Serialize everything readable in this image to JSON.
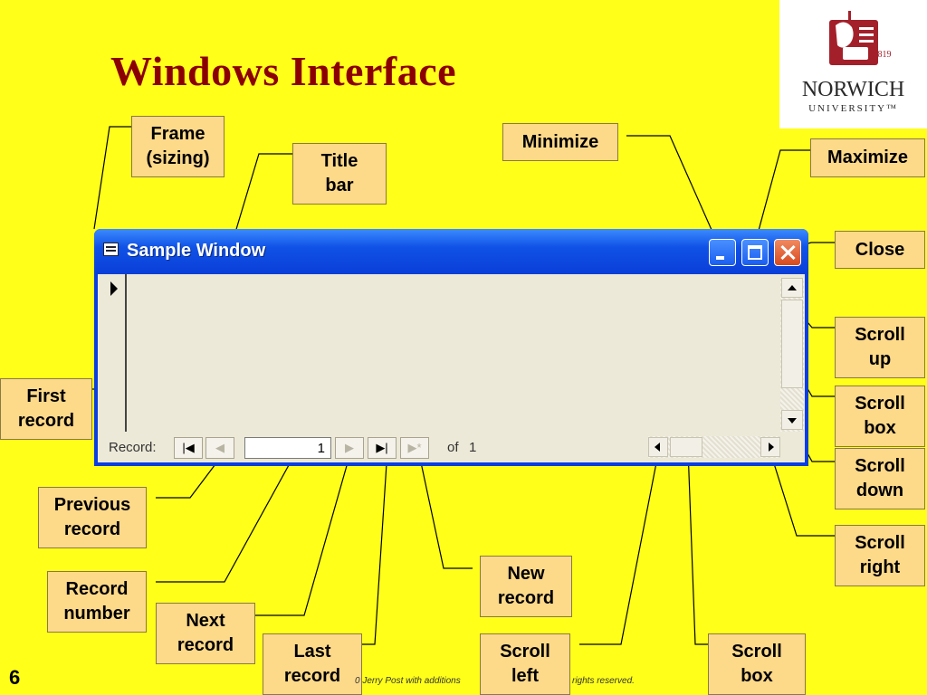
{
  "slide": {
    "title": "Windows Interface",
    "number": "6",
    "footer_left": "0 Jerry Post with additions",
    "footer_right": "rights reserved."
  },
  "logo": {
    "year": "1819",
    "name": "NORWICH",
    "subtitle": "UNIVERSITY™",
    "accent_color": "#a3202a"
  },
  "sample_window": {
    "title": "Sample Window",
    "icon": "form-window-icon",
    "title_bar_color": "#1052e6",
    "close_color": "#d84a20",
    "nav": {
      "record_label": "Record:",
      "record_number": "1",
      "of_label": "of",
      "record_total": "1",
      "first_glyph": "|◀",
      "prev_glyph": "◀",
      "next_glyph": "▶",
      "last_glyph": "▶|",
      "new_glyph": "▶*"
    }
  },
  "callouts": {
    "frame_sizing": "Frame\n(sizing)",
    "title_bar": "Title\nbar",
    "minimize": "Minimize",
    "maximize": "Maximize",
    "close": "Close",
    "scroll_up": "Scroll\nup",
    "scroll_box_vertical": "Scroll\nbox",
    "scroll_down": "Scroll\ndown",
    "scroll_right": "Scroll\nright",
    "first_record": "First\nrecord",
    "previous_record": "Previous\nrecord",
    "record_number": "Record\nnumber",
    "next_record": "Next\nrecord",
    "last_record": "Last\nrecord",
    "new_record": "New\nrecord",
    "scroll_left": "Scroll\nleft",
    "scroll_box_horizontal": "Scroll\nbox"
  },
  "colors": {
    "background": "#ffff1a",
    "title_text": "#8b0000",
    "callout_fill": "#fdd98a"
  }
}
